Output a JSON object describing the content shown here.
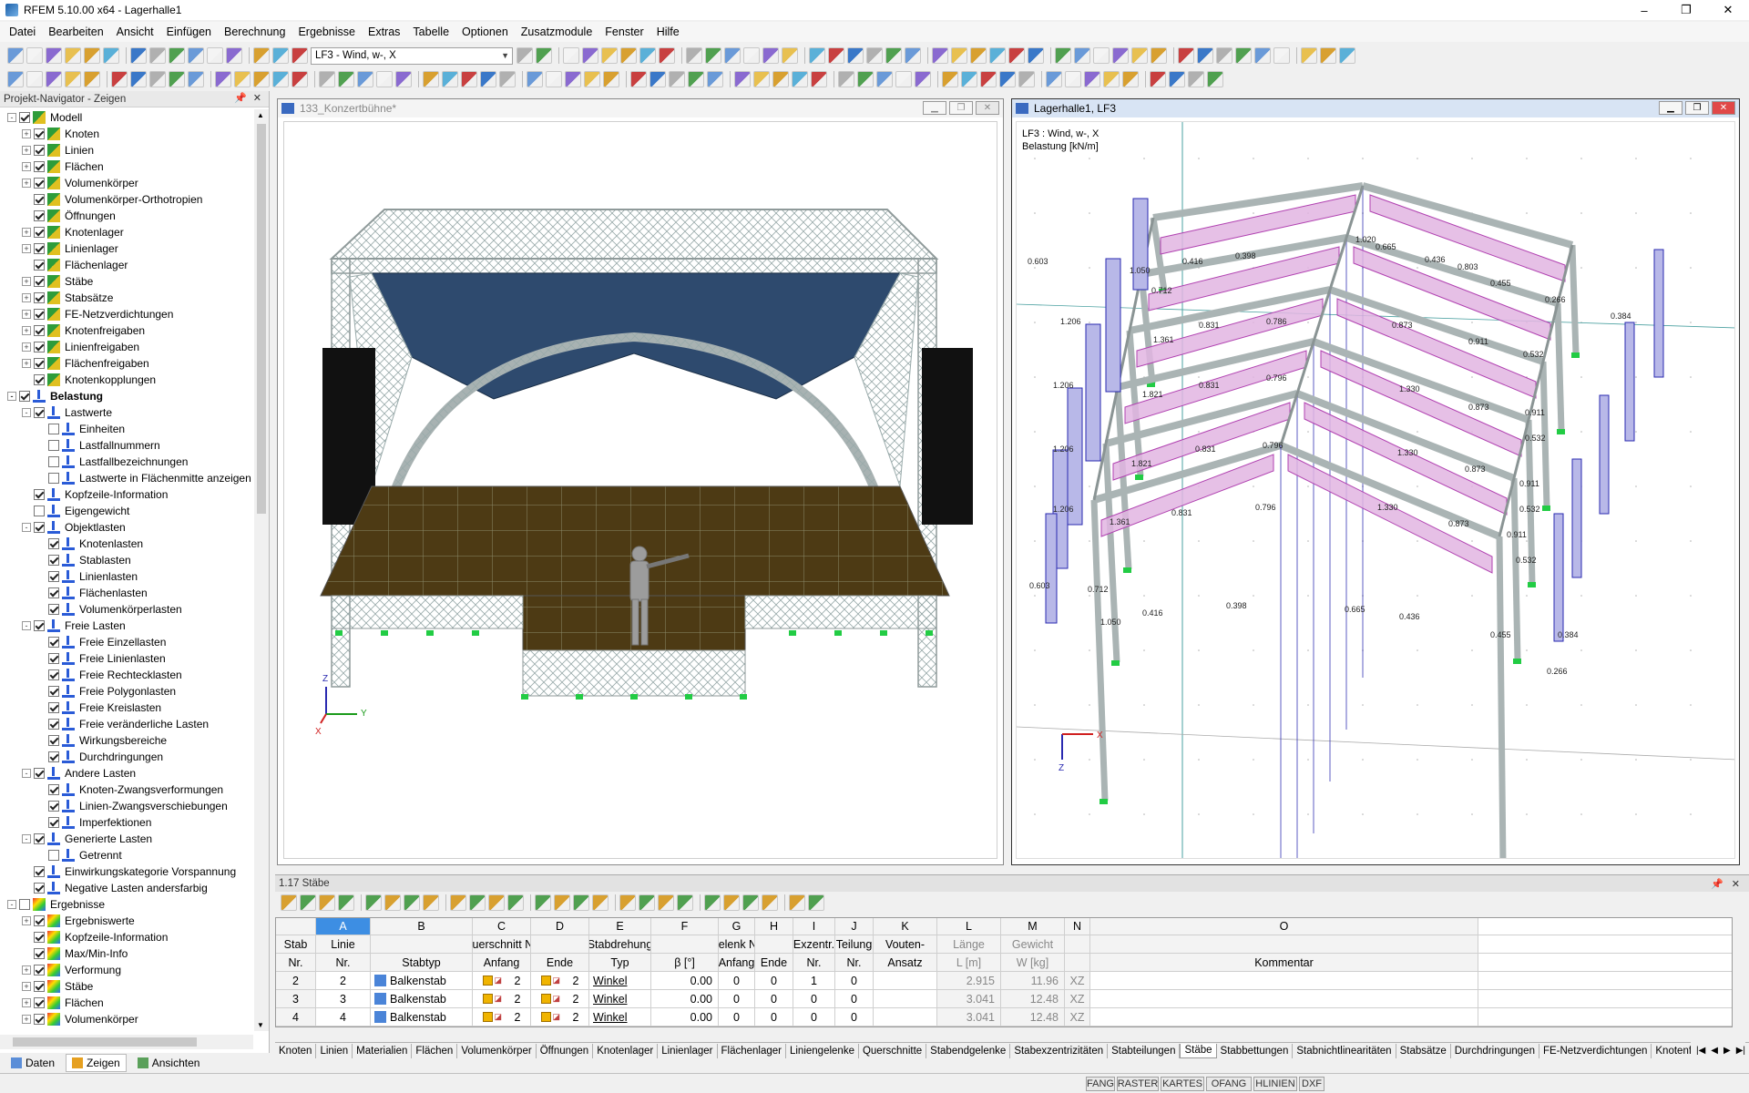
{
  "window": {
    "title": "RFEM 5.10.00 x64 - Lagerhalle1",
    "min": "–",
    "max": "❐",
    "close": "✕"
  },
  "menu": [
    "Datei",
    "Bearbeiten",
    "Ansicht",
    "Einfügen",
    "Berechnung",
    "Ergebnisse",
    "Extras",
    "Tabelle",
    "Optionen",
    "Zusatzmodule",
    "Fenster",
    "Hilfe"
  ],
  "toolbar": {
    "loadcase": "LF3 - Wind, w-, X"
  },
  "navigator": {
    "title": "Projekt-Navigator - Zeigen",
    "pin": "📌",
    "close": "✕",
    "items": [
      {
        "label": "Modell",
        "lvl": 0,
        "exp": "-",
        "cb": 1,
        "icon": "m"
      },
      {
        "label": "Knoten",
        "lvl": 1,
        "exp": "+",
        "cb": 1,
        "icon": "m"
      },
      {
        "label": "Linien",
        "lvl": 1,
        "exp": "+",
        "cb": 1,
        "icon": "m"
      },
      {
        "label": "Flächen",
        "lvl": 1,
        "exp": "+",
        "cb": 1,
        "icon": "m"
      },
      {
        "label": "Volumenkörper",
        "lvl": 1,
        "exp": "+",
        "cb": 1,
        "icon": "m"
      },
      {
        "label": "Volumenkörper-Orthotropien",
        "lvl": 1,
        "exp": "",
        "cb": 1,
        "icon": "m"
      },
      {
        "label": "Öffnungen",
        "lvl": 1,
        "exp": "",
        "cb": 1,
        "icon": "m"
      },
      {
        "label": "Knotenlager",
        "lvl": 1,
        "exp": "+",
        "cb": 1,
        "icon": "m"
      },
      {
        "label": "Linienlager",
        "lvl": 1,
        "exp": "+",
        "cb": 1,
        "icon": "m"
      },
      {
        "label": "Flächenlager",
        "lvl": 1,
        "exp": "",
        "cb": 1,
        "icon": "m"
      },
      {
        "label": "Stäbe",
        "lvl": 1,
        "exp": "+",
        "cb": 1,
        "icon": "m"
      },
      {
        "label": "Stabsätze",
        "lvl": 1,
        "exp": "+",
        "cb": 1,
        "icon": "m"
      },
      {
        "label": "FE-Netzverdichtungen",
        "lvl": 1,
        "exp": "+",
        "cb": 1,
        "icon": "m"
      },
      {
        "label": "Knotenfreigaben",
        "lvl": 1,
        "exp": "+",
        "cb": 1,
        "icon": "m"
      },
      {
        "label": "Linienfreigaben",
        "lvl": 1,
        "exp": "+",
        "cb": 1,
        "icon": "m"
      },
      {
        "label": "Flächenfreigaben",
        "lvl": 1,
        "exp": "+",
        "cb": 1,
        "icon": "m"
      },
      {
        "label": "Knotenkopplungen",
        "lvl": 1,
        "exp": "",
        "cb": 1,
        "icon": "m"
      },
      {
        "label": "Belastung",
        "lvl": 0,
        "exp": "-",
        "cb": 1,
        "icon": "l",
        "bold": 1
      },
      {
        "label": "Lastwerte",
        "lvl": 1,
        "exp": "-",
        "cb": 1,
        "icon": "l"
      },
      {
        "label": "Einheiten",
        "lvl": 2,
        "exp": "",
        "cb": 0,
        "icon": "l"
      },
      {
        "label": "Lastfallnummern",
        "lvl": 2,
        "exp": "",
        "cb": 0,
        "icon": "l"
      },
      {
        "label": "Lastfallbezeichnungen",
        "lvl": 2,
        "exp": "",
        "cb": 0,
        "icon": "l"
      },
      {
        "label": "Lastwerte in Flächenmitte anzeigen",
        "lvl": 2,
        "exp": "",
        "cb": 0,
        "icon": "l"
      },
      {
        "label": "Kopfzeile-Information",
        "lvl": 1,
        "exp": "",
        "cb": 1,
        "icon": "l"
      },
      {
        "label": "Eigengewicht",
        "lvl": 1,
        "exp": "",
        "cb": 0,
        "icon": "l"
      },
      {
        "label": "Objektlasten",
        "lvl": 1,
        "exp": "-",
        "cb": 1,
        "icon": "l"
      },
      {
        "label": "Knotenlasten",
        "lvl": 2,
        "exp": "",
        "cb": 1,
        "icon": "l"
      },
      {
        "label": "Stablasten",
        "lvl": 2,
        "exp": "",
        "cb": 1,
        "icon": "l"
      },
      {
        "label": "Linienlasten",
        "lvl": 2,
        "exp": "",
        "cb": 1,
        "icon": "l"
      },
      {
        "label": "Flächenlasten",
        "lvl": 2,
        "exp": "",
        "cb": 1,
        "icon": "l"
      },
      {
        "label": "Volumenkörperlasten",
        "lvl": 2,
        "exp": "",
        "cb": 1,
        "icon": "l"
      },
      {
        "label": "Freie Lasten",
        "lvl": 1,
        "exp": "-",
        "cb": 1,
        "icon": "l"
      },
      {
        "label": "Freie Einzellasten",
        "lvl": 2,
        "exp": "",
        "cb": 1,
        "icon": "l"
      },
      {
        "label": "Freie Linienlasten",
        "lvl": 2,
        "exp": "",
        "cb": 1,
        "icon": "l"
      },
      {
        "label": "Freie Rechtecklasten",
        "lvl": 2,
        "exp": "",
        "cb": 1,
        "icon": "l"
      },
      {
        "label": "Freie Polygonlasten",
        "lvl": 2,
        "exp": "",
        "cb": 1,
        "icon": "l"
      },
      {
        "label": "Freie Kreislasten",
        "lvl": 2,
        "exp": "",
        "cb": 1,
        "icon": "l"
      },
      {
        "label": "Freie veränderliche Lasten",
        "lvl": 2,
        "exp": "",
        "cb": 1,
        "icon": "l"
      },
      {
        "label": "Wirkungsbereiche",
        "lvl": 2,
        "exp": "",
        "cb": 1,
        "icon": "l"
      },
      {
        "label": "Durchdringungen",
        "lvl": 2,
        "exp": "",
        "cb": 1,
        "icon": "l"
      },
      {
        "label": "Andere Lasten",
        "lvl": 1,
        "exp": "-",
        "cb": 1,
        "icon": "l"
      },
      {
        "label": "Knoten-Zwangsverformungen",
        "lvl": 2,
        "exp": "",
        "cb": 1,
        "icon": "l"
      },
      {
        "label": "Linien-Zwangsverschiebungen",
        "lvl": 2,
        "exp": "",
        "cb": 1,
        "icon": "l"
      },
      {
        "label": "Imperfektionen",
        "lvl": 2,
        "exp": "",
        "cb": 1,
        "icon": "l"
      },
      {
        "label": "Generierte Lasten",
        "lvl": 1,
        "exp": "-",
        "cb": 1,
        "icon": "l"
      },
      {
        "label": "Getrennt",
        "lvl": 2,
        "exp": "",
        "cb": 0,
        "icon": "l"
      },
      {
        "label": "Einwirkungskategorie Vorspannung",
        "lvl": 1,
        "exp": "",
        "cb": 1,
        "icon": "l"
      },
      {
        "label": "Negative Lasten andersfarbig",
        "lvl": 1,
        "exp": "",
        "cb": 1,
        "icon": "l"
      },
      {
        "label": "Ergebnisse",
        "lvl": 0,
        "exp": "-",
        "cb": 0,
        "icon": "r"
      },
      {
        "label": "Ergebniswerte",
        "lvl": 1,
        "exp": "+",
        "cb": 1,
        "icon": "r"
      },
      {
        "label": "Kopfzeile-Information",
        "lvl": 1,
        "exp": "",
        "cb": 1,
        "icon": "r"
      },
      {
        "label": "Max/Min-Info",
        "lvl": 1,
        "exp": "",
        "cb": 1,
        "icon": "r"
      },
      {
        "label": "Verformung",
        "lvl": 1,
        "exp": "+",
        "cb": 1,
        "icon": "r"
      },
      {
        "label": "Stäbe",
        "lvl": 1,
        "exp": "+",
        "cb": 1,
        "icon": "r"
      },
      {
        "label": "Flächen",
        "lvl": 1,
        "exp": "+",
        "cb": 1,
        "icon": "r"
      },
      {
        "label": "Volumenkörper",
        "lvl": 1,
        "exp": "+",
        "cb": 1,
        "icon": "r"
      }
    ],
    "tabs": [
      "Daten",
      "Zeigen",
      "Ansichten"
    ]
  },
  "views": {
    "left": {
      "title": "133_Konzertbühne*"
    },
    "right": {
      "title": "Lagerhalle1, LF3",
      "info1": "LF3 : Wind, w-, X",
      "info2": "Belastung [kN/m]"
    },
    "axes": {
      "z": "Z",
      "y": "Y",
      "x": "X"
    }
  },
  "load_labels": [
    {
      "t": "0.603"
    },
    {
      "t": "1.206"
    },
    {
      "t": "1.206"
    },
    {
      "t": "1.206"
    },
    {
      "t": "1.206"
    },
    {
      "t": "0.603"
    },
    {
      "t": "1.050"
    },
    {
      "t": "0.416"
    },
    {
      "t": "0.398"
    },
    {
      "t": "1.020"
    },
    {
      "t": "0.665"
    },
    {
      "t": "0.436"
    },
    {
      "t": "0.803"
    },
    {
      "t": "0.455"
    },
    {
      "t": "0.266"
    },
    {
      "t": "0.384"
    },
    {
      "t": "0.712"
    },
    {
      "t": "1.361"
    },
    {
      "t": "0.831"
    },
    {
      "t": "0.786"
    },
    {
      "t": "0.873"
    },
    {
      "t": "0.911"
    },
    {
      "t": "0.532"
    },
    {
      "t": "1.821"
    },
    {
      "t": "0.831"
    },
    {
      "t": "0.796"
    },
    {
      "t": "1.330"
    },
    {
      "t": "0.873"
    },
    {
      "t": "0.911"
    },
    {
      "t": "0.532"
    },
    {
      "t": "1.821"
    },
    {
      "t": "0.831"
    },
    {
      "t": "0.796"
    },
    {
      "t": "1.330"
    },
    {
      "t": "0.873"
    },
    {
      "t": "0.911"
    },
    {
      "t": "0.532"
    },
    {
      "t": "1.361"
    },
    {
      "t": "0.831"
    },
    {
      "t": "0.796"
    },
    {
      "t": "1.330"
    },
    {
      "t": "0.873"
    },
    {
      "t": "0.911"
    },
    {
      "t": "0.532"
    },
    {
      "t": "0.712"
    },
    {
      "t": "1.050"
    },
    {
      "t": "0.416"
    },
    {
      "t": "0.398"
    },
    {
      "t": "0.665"
    },
    {
      "t": "0.436"
    },
    {
      "t": "0.455"
    },
    {
      "t": "0.384"
    },
    {
      "t": "0.266"
    }
  ],
  "table": {
    "title": "1.17 Stäbe",
    "letters": [
      "A",
      "B",
      "C",
      "D",
      "E",
      "F",
      "G",
      "H",
      "I",
      "J",
      "K",
      "L",
      "M",
      "N",
      "O"
    ],
    "head1": [
      "Stab",
      "Linie",
      "",
      "Querschnitt Nr.",
      "",
      "Stabdrehung",
      "",
      "Gelenk Nr.",
      "",
      "Exzentr.",
      "Teilung",
      "Vouten-",
      "Länge",
      "Gewicht",
      "",
      ""
    ],
    "head2": [
      "Nr.",
      "Nr.",
      "Stabtyp",
      "Anfang",
      "Ende",
      "Typ",
      "β [°]",
      "Anfang",
      "Ende",
      "Nr.",
      "Nr.",
      "Ansatz",
      "L [m]",
      "W [kg]",
      "",
      "Kommentar"
    ],
    "rows": [
      {
        "nr": "2",
        "linie": "2",
        "typ": "Balkenstab",
        "qa": "2",
        "qe": "2",
        "dtyp": "Winkel",
        "beta": "0.00",
        "ga": "0",
        "ge": "0",
        "ex": "1",
        "teil": "0",
        "vout": "",
        "len": "2.915",
        "gew": "11.96",
        "dir": "XZ",
        "kom": ""
      },
      {
        "nr": "3",
        "linie": "3",
        "typ": "Balkenstab",
        "qa": "2",
        "qe": "2",
        "dtyp": "Winkel",
        "beta": "0.00",
        "ga": "0",
        "ge": "0",
        "ex": "0",
        "teil": "0",
        "vout": "",
        "len": "3.041",
        "gew": "12.48",
        "dir": "XZ",
        "kom": ""
      },
      {
        "nr": "4",
        "linie": "4",
        "typ": "Balkenstab",
        "qa": "2",
        "qe": "2",
        "dtyp": "Winkel",
        "beta": "0.00",
        "ga": "0",
        "ge": "0",
        "ex": "0",
        "teil": "0",
        "vout": "",
        "len": "3.041",
        "gew": "12.48",
        "dir": "XZ",
        "kom": ""
      }
    ],
    "tabs": [
      "Knoten",
      "Linien",
      "Materialien",
      "Flächen",
      "Volumenkörper",
      "Öffnungen",
      "Knotenlager",
      "Linienlager",
      "Flächenlager",
      "Liniengelenke",
      "Querschnitte",
      "Stabendgelenke",
      "Stabexzentrizitäten",
      "Stabteilungen",
      "Stäbe",
      "Stabbettungen",
      "Stabnichtlinearitäten",
      "Stabsätze",
      "Durchdringungen",
      "FE-Netzverdichtungen",
      "Knotenfreigaben"
    ],
    "active_tab": "Stäbe"
  },
  "status": [
    "FANG",
    "RASTER",
    "KARTES",
    "OFANG",
    "HLINIEN",
    "DXF"
  ],
  "colors": {
    "accent": "#3d8ee3",
    "load": "#b040b0",
    "loadfill": "#e2b5e2",
    "steel": "#aab4b4",
    "support": "#22cc44",
    "blueload": "#2a2ab0"
  }
}
